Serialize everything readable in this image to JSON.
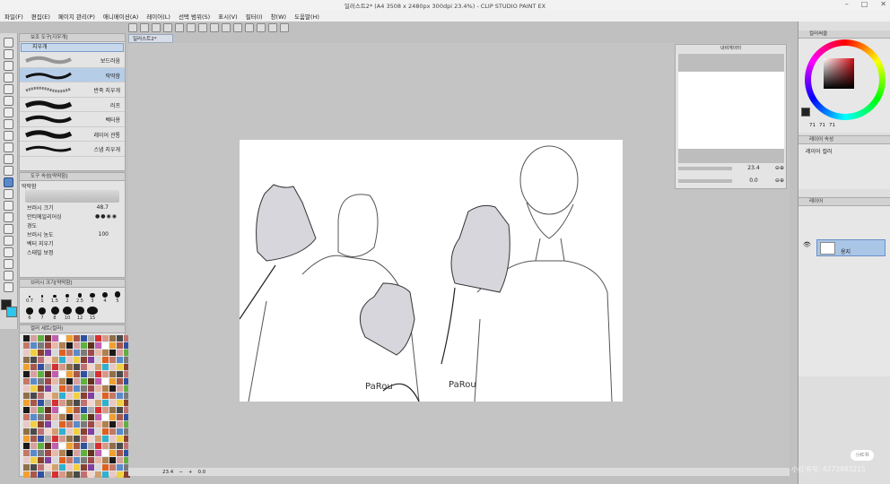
{
  "window": {
    "title": "일러스트2* (A4 3508 x 2480px 300dpi 23.4%) - CLIP STUDIO PAINT EX"
  },
  "menu": [
    "파일(F)",
    "편집(E)",
    "페이지 관리(P)",
    "애니메이션(A)",
    "레이어(L)",
    "선택 범위(S)",
    "표시(V)",
    "필터(I)",
    "창(W)",
    "도움말(H)"
  ],
  "subtool": {
    "header": "보조 도구[지우개]",
    "tab": "지우개",
    "items": [
      {
        "label": "보드러움"
      },
      {
        "label": "딱딱함"
      },
      {
        "label": "반죽 지우개"
      },
      {
        "label": "러프"
      },
      {
        "label": "벡터용"
      },
      {
        "label": "레이어 관통"
      },
      {
        "label": "스냅 지우개"
      }
    ]
  },
  "tool_property": {
    "header": "도구 속성[딱딱함]",
    "name": "딱딱함",
    "brush_size_label": "브러시 크기",
    "brush_size_value": "48.7",
    "antialias_label": "안티에일리어싱",
    "hardness_label": "경도",
    "density_label": "브러시 농도",
    "density_value": "100",
    "vector_eraser_label": "벡터 지우기",
    "more_label": "스태빌 보정"
  },
  "brush_size": {
    "header": "브러시 크기[딱딱함]",
    "sizes": [
      "0.7",
      "1",
      "1.5",
      "2",
      "2.5",
      "3",
      "4",
      "5",
      "6",
      "7",
      "8",
      "10",
      "12",
      "15"
    ]
  },
  "color_set": {
    "header": "컬러 세트(컬러)"
  },
  "canvas": {
    "tab_label": "일러스트2*",
    "signature_left": "PaRou",
    "signature_right": "PaRou"
  },
  "navigator": {
    "header": "내비게이터",
    "zoom": "23.4",
    "rotation": "0.0"
  },
  "status": {
    "zoom": "23.4",
    "rotation": "0.0"
  },
  "color_wheel": {
    "header": "컬러써클",
    "r": "71",
    "g": "71",
    "b": "71",
    "main_color": "#d10a12"
  },
  "layer_property": {
    "header": "레이어 속성",
    "label": "레이어 컬러"
  },
  "layers": {
    "header": "레이어",
    "items": [
      {
        "name": "용지"
      }
    ]
  },
  "watermark": {
    "text": "小红书号: 4273983215"
  },
  "badge": {
    "text": "小红书"
  }
}
